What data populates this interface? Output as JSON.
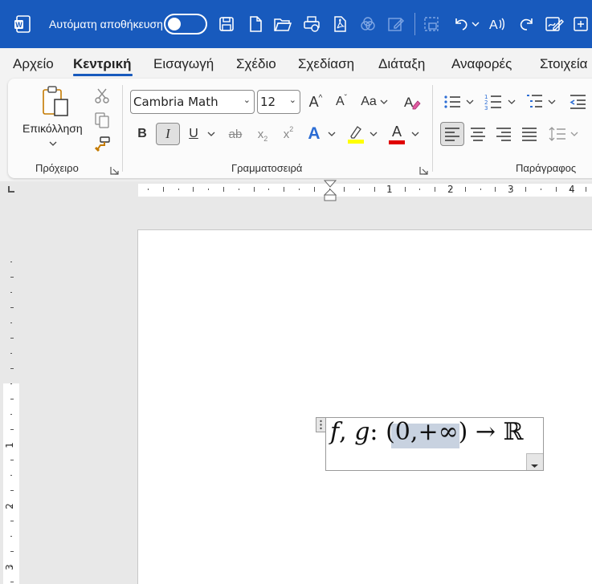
{
  "titlebar": {
    "autosave_label": "Αυτόματη αποθήκευση",
    "autosave_on": false,
    "icons": [
      "word-icon",
      "save-icon",
      "new-document-icon",
      "open-folder-icon",
      "print-preview-icon",
      "pdf-icon",
      "design-checker-icon",
      "edit-icon",
      "screenshot-icon",
      "undo-icon",
      "read-aloud-icon",
      "redo-icon",
      "signature-icon",
      "more-icon"
    ]
  },
  "tabs": [
    {
      "label": "Αρχείο",
      "active": false
    },
    {
      "label": "Κεντρική",
      "active": true
    },
    {
      "label": "Εισαγωγή",
      "active": false
    },
    {
      "label": "Σχέδιο",
      "active": false
    },
    {
      "label": "Σχεδίαση",
      "active": false
    },
    {
      "label": "Διάταξη",
      "active": false
    },
    {
      "label": "Αναφορές",
      "active": false
    },
    {
      "label": "Στοιχεία",
      "active": false
    }
  ],
  "ribbon": {
    "clipboard": {
      "label": "Πρόχειρο",
      "paste_label": "Επικόλληση",
      "icons": [
        "paste-icon",
        "cut-icon",
        "copy-icon",
        "format-painter-icon"
      ]
    },
    "font": {
      "label": "Γραμματοσειρά",
      "font_name": "Cambria Math",
      "font_size": "12",
      "bold": "B",
      "italic": "I",
      "underline": "U",
      "strike": "ab",
      "subscript": "x",
      "subscript_mark": "2",
      "superscript": "x",
      "superscript_mark": "2",
      "change_case": "Aa",
      "grow": "A",
      "shrink": "A",
      "text_effects": "A",
      "font_color": "A",
      "highlight_color": "#ffff00",
      "font_color_value": "#e00000"
    },
    "paragraph": {
      "label": "Παράγραφος"
    }
  },
  "ruler": {
    "numbers": [
      "1",
      "2",
      "3",
      "4"
    ],
    "vertical_numbers": [
      "1",
      "2",
      "3"
    ]
  },
  "equation": {
    "f": "f",
    "sep1": ",",
    "g": "g",
    "colon": ":",
    "lparen": "(",
    "zero": "0",
    "comma": ",",
    "plus_inf": "+∞",
    "rparen": ")",
    "arrow": "→",
    "reals": "ℝ"
  },
  "colors": {
    "accent": "#185abd",
    "ribbon_bg": "#f3f3f3",
    "highlight": "#c8d2e0"
  }
}
